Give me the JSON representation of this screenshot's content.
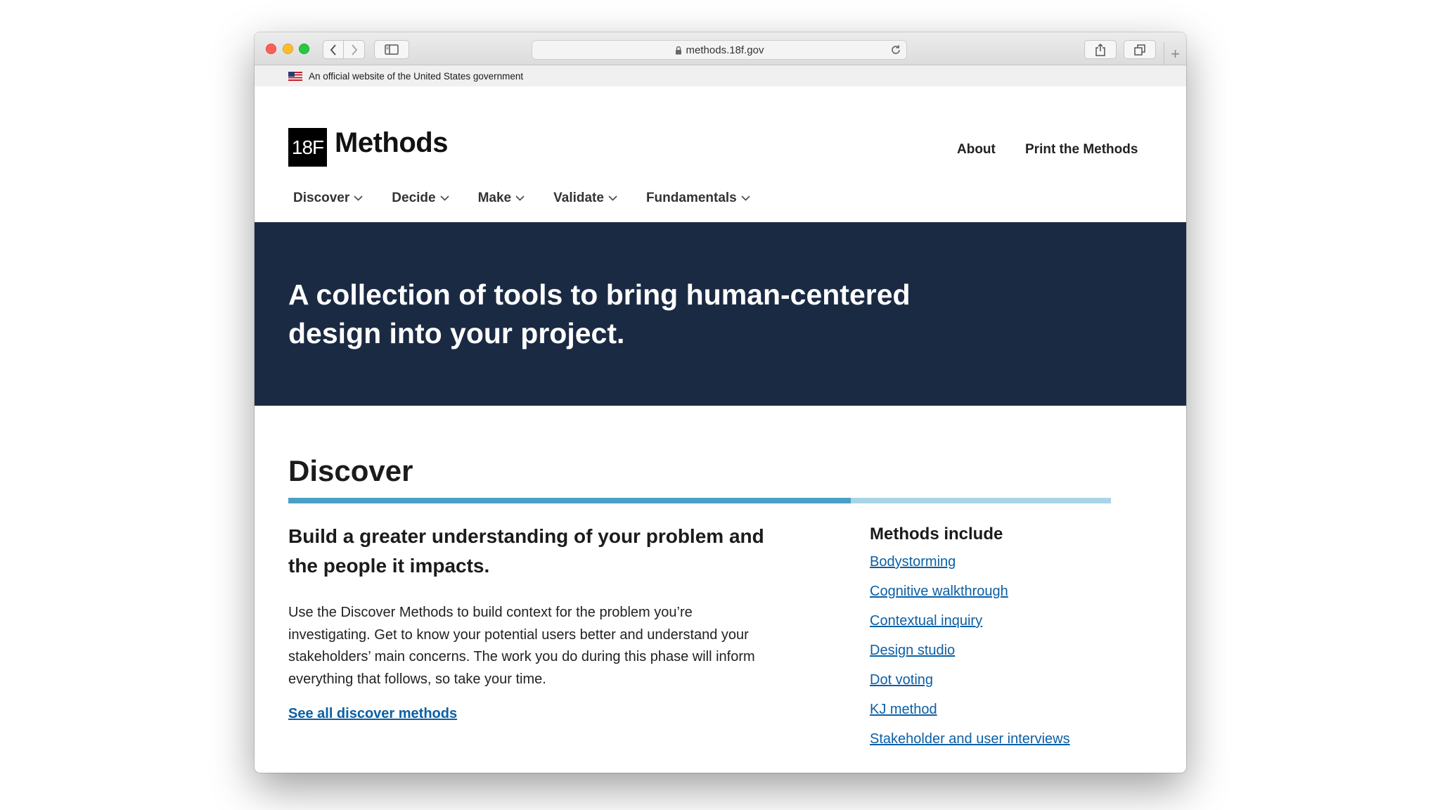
{
  "browser": {
    "url": "methods.18f.gov"
  },
  "gov_banner": {
    "text": "An official website of the United States government"
  },
  "header": {
    "logo_mark": "18F",
    "logo_text": "Methods",
    "top_links": [
      "About",
      "Print the Methods"
    ]
  },
  "nav": {
    "items": [
      "Discover",
      "Decide",
      "Make",
      "Validate",
      "Fundamentals"
    ]
  },
  "hero": {
    "heading": "A collection of tools to bring human-centered design into your project."
  },
  "discover": {
    "title": "Discover",
    "progress_fraction": 0.684,
    "lead": "Build a greater understanding of your problem and the people it impacts.",
    "body": "Use the Discover Methods to build context for the problem you’re investigating. Get to know your potential users better and understand your stakeholders’ main concerns. The work you do during this phase will inform everything that follows, so take your time.",
    "see_all": "See all discover methods",
    "methods_heading": "Methods include",
    "methods": [
      "Bodystorming",
      "Cognitive walkthrough",
      "Contextual inquiry",
      "Design studio",
      "Dot voting",
      "KJ method",
      "Stakeholder and user interviews"
    ]
  },
  "colors": {
    "hero_bg": "#1b2a43",
    "link": "#0b5fa5",
    "rule_fill": "#4a9fc4",
    "rule_track": "#a9d4e6"
  }
}
